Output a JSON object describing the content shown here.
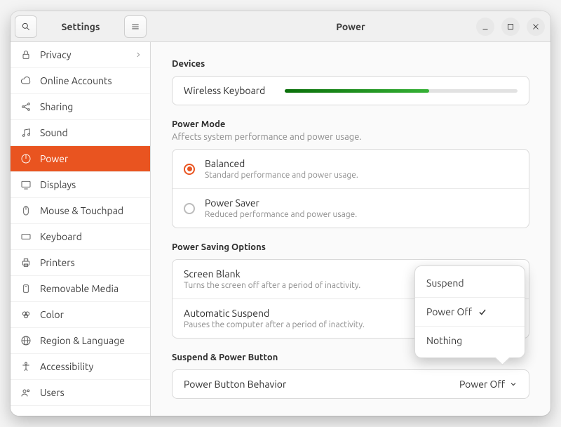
{
  "header": {
    "sidebar_title": "Settings",
    "content_title": "Power"
  },
  "sidebar": {
    "items": [
      {
        "id": "privacy",
        "label": "Privacy",
        "has_sub": true
      },
      {
        "id": "online-accounts",
        "label": "Online Accounts"
      },
      {
        "id": "sharing",
        "label": "Sharing"
      },
      {
        "id": "sound",
        "label": "Sound"
      },
      {
        "id": "power",
        "label": "Power",
        "active": true
      },
      {
        "id": "displays",
        "label": "Displays"
      },
      {
        "id": "mouse-touchpad",
        "label": "Mouse & Touchpad"
      },
      {
        "id": "keyboard",
        "label": "Keyboard"
      },
      {
        "id": "printers",
        "label": "Printers"
      },
      {
        "id": "removable-media",
        "label": "Removable Media"
      },
      {
        "id": "color",
        "label": "Color"
      },
      {
        "id": "region-language",
        "label": "Region & Language"
      },
      {
        "id": "accessibility",
        "label": "Accessibility"
      },
      {
        "id": "users",
        "label": "Users"
      }
    ]
  },
  "sections": {
    "devices": {
      "title": "Devices",
      "wireless_keyboard": "Wireless Keyboard",
      "battery_pct": 62
    },
    "power_mode": {
      "title": "Power Mode",
      "subtitle": "Affects system performance and power usage.",
      "balanced": {
        "title": "Balanced",
        "sub": "Standard performance and power usage."
      },
      "saver": {
        "title": "Power Saver",
        "sub": "Reduced performance and power usage."
      }
    },
    "power_saving": {
      "title": "Power Saving Options",
      "screen_blank": {
        "title": "Screen Blank",
        "sub": "Turns the screen off after a period of inactivity."
      },
      "auto_suspend": {
        "title": "Automatic Suspend",
        "sub": "Pauses the computer after a period of inactivity."
      }
    },
    "suspend_button": {
      "title": "Suspend & Power Button",
      "behavior": {
        "title": "Power Button Behavior",
        "value": "Power Off"
      }
    }
  },
  "popover": {
    "suspend": "Suspend",
    "power_off": "Power Off",
    "nothing": "Nothing"
  }
}
